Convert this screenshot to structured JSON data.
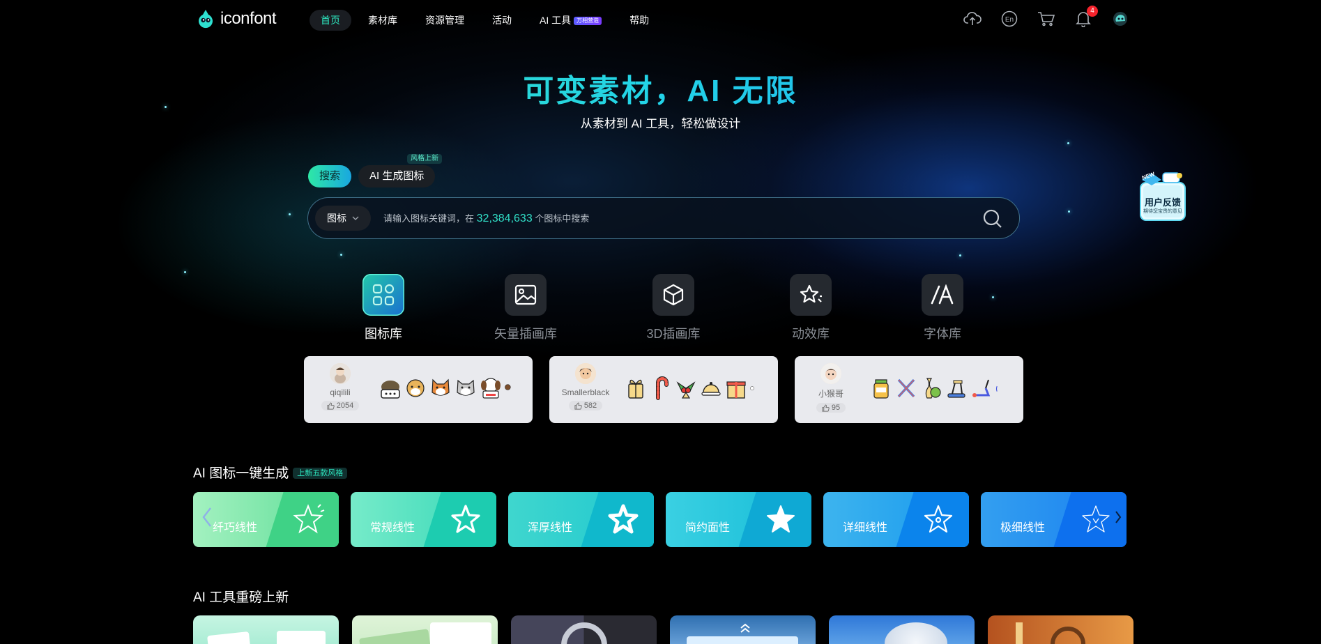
{
  "header": {
    "logo_text": "iconfont",
    "nav": [
      {
        "label": "首页",
        "active": true
      },
      {
        "label": "素材库"
      },
      {
        "label": "资源管理"
      },
      {
        "label": "活动"
      },
      {
        "label": "AI 工具",
        "badge": "万相营造"
      },
      {
        "label": "帮助"
      }
    ],
    "icons": [
      "upload-icon",
      "language-en-icon",
      "cart-icon",
      "bell-icon",
      "avatar-icon"
    ],
    "notification_count": "4"
  },
  "hero": {
    "title": "可变素材，AI 无限",
    "subtitle": "从素材到 AI 工具，轻松做设计"
  },
  "search_tabs": [
    {
      "label": "搜索",
      "active": true
    },
    {
      "label": "AI 生成图标",
      "tag": "风格上新"
    }
  ],
  "search": {
    "type": "图标",
    "placeholder_prefix": "请输入图标关键词，在",
    "count": "32,384,633",
    "placeholder_suffix": "个图标中搜索"
  },
  "categories": [
    {
      "label": "图标库",
      "icon": "grid-icon",
      "active": true
    },
    {
      "label": "矢量插画库",
      "icon": "image-icon"
    },
    {
      "label": "3D插画库",
      "icon": "cube-icon"
    },
    {
      "label": "动效库",
      "icon": "sparkle-star-icon"
    },
    {
      "label": "字体库",
      "icon": "font-icon"
    }
  ],
  "author_cards": [
    {
      "name": "qiqilili",
      "likes": "2054"
    },
    {
      "name": "Smallerblack",
      "likes": "582"
    },
    {
      "name": "小猴哥",
      "likes": "95"
    }
  ],
  "ai_section": {
    "title": "AI 图标一键生成",
    "tag": "上新五款风格",
    "styles": [
      {
        "label": "纤巧线性",
        "from": "#9df2b8",
        "to": "#47d88e"
      },
      {
        "label": "常规线性",
        "from": "#6ee9c5",
        "to": "#22d1b5"
      },
      {
        "label": "浑厚线性",
        "from": "#3fd8d0",
        "to": "#14c0d0"
      },
      {
        "label": "简约面性",
        "from": "#3cd0e0",
        "to": "#14b3d8"
      },
      {
        "label": "详细线性",
        "from": "#3bb4f0",
        "to": "#0f8ef0"
      },
      {
        "label": "极细线性",
        "from": "#2f9cf2",
        "to": "#1378f0"
      }
    ]
  },
  "tools_section": {
    "title": "AI 工具重磅上新"
  },
  "feedback": {
    "new": "NEW",
    "title": "用户反馈",
    "sub": "期待您宝贵的意见"
  }
}
